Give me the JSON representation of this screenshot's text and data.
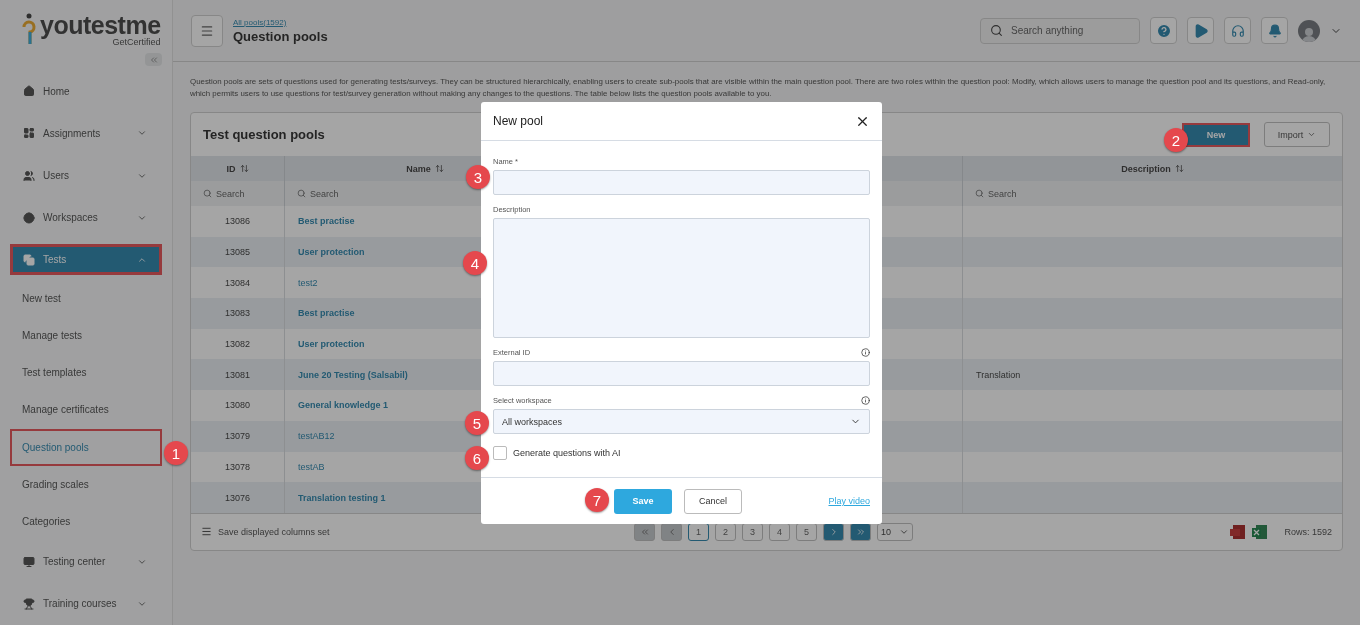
{
  "logo": {
    "name": "youtestme",
    "tagline": "GetCertified"
  },
  "sidebar": {
    "items": [
      {
        "kind": "link",
        "label": "Home",
        "selected": false,
        "highlighted": false
      },
      {
        "kind": "group",
        "label": "Assignments",
        "expanded": false,
        "selected": false,
        "highlighted": false
      },
      {
        "kind": "group",
        "label": "Users",
        "expanded": false,
        "selected": false,
        "highlighted": false
      },
      {
        "kind": "group",
        "label": "Workspaces",
        "expanded": false,
        "selected": false,
        "highlighted": false
      },
      {
        "kind": "group",
        "label": "Tests",
        "expanded": true,
        "selected": true,
        "highlighted": true,
        "children": [
          {
            "label": "New test",
            "selected": false,
            "highlighted": false
          },
          {
            "label": "Manage tests",
            "selected": false,
            "highlighted": false
          },
          {
            "label": "Test templates",
            "selected": false,
            "highlighted": false
          },
          {
            "label": "Manage certificates",
            "selected": false,
            "highlighted": false
          },
          {
            "label": "Question pools",
            "selected": true,
            "highlighted": true
          },
          {
            "label": "Grading scales",
            "selected": false,
            "highlighted": false
          },
          {
            "label": "Categories",
            "selected": false,
            "highlighted": false
          }
        ]
      },
      {
        "kind": "group",
        "label": "Testing center",
        "expanded": false,
        "selected": false,
        "highlighted": false
      },
      {
        "kind": "group",
        "label": "Training courses",
        "expanded": false,
        "selected": false,
        "highlighted": false
      }
    ]
  },
  "header": {
    "breadcrumb": "All pools(1592)",
    "title": "Question pools",
    "search": {
      "placeholder": "Search anything"
    }
  },
  "intro": "Question pools are sets of questions used for generating tests/surveys. They can be structured hierarchically, enabling users to create sub-pools that are visible within the main question pool. There are two roles within the question pool: Modify, which allows users to manage the question pool and its questions, and Read-only, which permits users to use questions for test/survey generation without making any changes to the questions. The table below lists the question pools available to you.",
  "card": {
    "title": "Test question pools",
    "new_button": {
      "label": "New",
      "highlighted": true
    },
    "import_button": "Import"
  },
  "table": {
    "columns": [
      "ID",
      "Name",
      "Description"
    ],
    "search_placeholders": [
      "Search",
      "Search",
      "Search"
    ],
    "rows": [
      {
        "id": "13086",
        "name": "Best practise",
        "link": true
      },
      {
        "id": "13085",
        "name": "User protection",
        "link": true
      },
      {
        "id": "13084",
        "name": "test2",
        "link": false
      },
      {
        "id": "13083",
        "name": "Best practise",
        "link": true
      },
      {
        "id": "13082",
        "name": "User protection",
        "link": true
      },
      {
        "id": "13081",
        "name": "June 20 Testing (Salsabil)",
        "link": true,
        "description": "Translation"
      },
      {
        "id": "13080",
        "name": "General knowledge 1",
        "link": true
      },
      {
        "id": "13079",
        "name": "testAB12",
        "link": false
      },
      {
        "id": "13078",
        "name": "testAB",
        "link": false
      },
      {
        "id": "13076",
        "name": "Translation testing 1",
        "link": true
      }
    ]
  },
  "footer": {
    "save_columns": "Save displayed columns set",
    "pagination": {
      "first_disabled": true,
      "prev_disabled": true,
      "next_disabled": false,
      "last_disabled": false,
      "pages": [
        {
          "label": "1",
          "selected": true
        },
        {
          "label": "2",
          "selected": false
        },
        {
          "label": "3",
          "selected": false
        },
        {
          "label": "4",
          "selected": false
        },
        {
          "label": "5",
          "selected": false
        }
      ],
      "page_size": "10"
    },
    "rows_count": "Rows: 1592"
  },
  "dialog": {
    "title": "New pool",
    "fields": [
      {
        "kind": "input",
        "label": "Name *",
        "info": false
      },
      {
        "kind": "textarea",
        "label": "Description",
        "info": false
      },
      {
        "kind": "input",
        "label": "External ID",
        "info": true
      },
      {
        "kind": "select",
        "label": "Select workspace",
        "value": "All workspaces",
        "info": true
      }
    ],
    "checkbox": {
      "label": "Generate questions with AI",
      "checked": false
    },
    "buttons": {
      "save": "Save",
      "cancel": "Cancel",
      "video": "Play video"
    }
  },
  "markers": [
    "1",
    "2",
    "3",
    "4",
    "5",
    "6",
    "7"
  ]
}
